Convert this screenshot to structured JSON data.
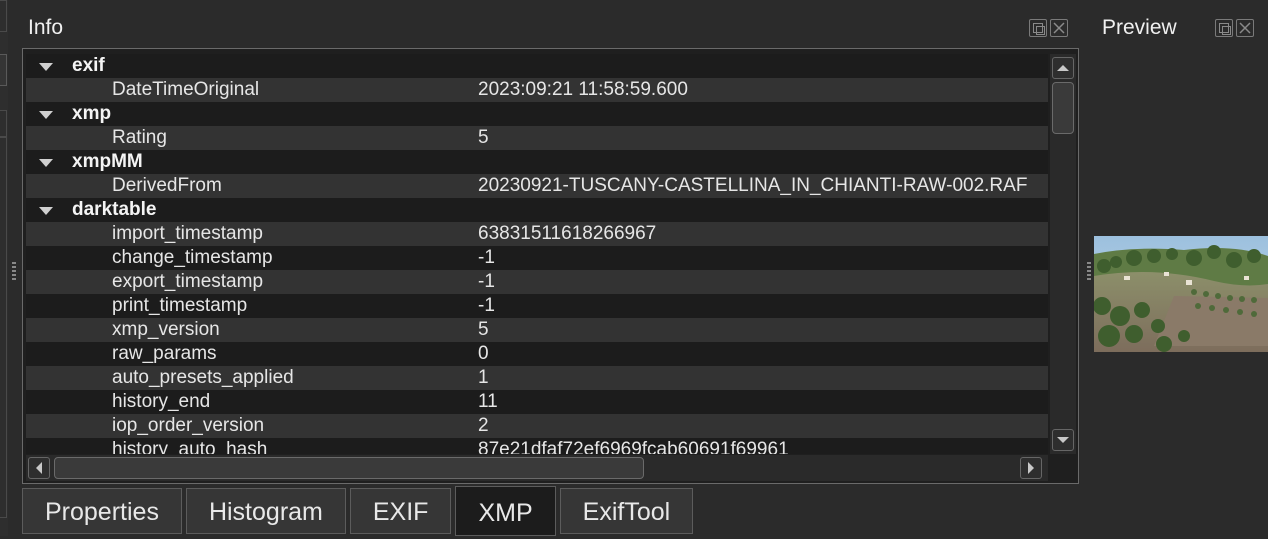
{
  "info_panel": {
    "title": "Info"
  },
  "preview_panel": {
    "title": "Preview"
  },
  "tree": {
    "rows": [
      {
        "kind": "group",
        "name": "exif"
      },
      {
        "kind": "item",
        "name": "DateTimeOriginal",
        "value": "2023:09:21 11:58:59.600"
      },
      {
        "kind": "group",
        "name": "xmp"
      },
      {
        "kind": "item",
        "name": "Rating",
        "value": "5"
      },
      {
        "kind": "group",
        "name": "xmpMM"
      },
      {
        "kind": "item",
        "name": "DerivedFrom",
        "value": "20230921-TUSCANY-CASTELLINA_IN_CHIANTI-RAW-002.RAF"
      },
      {
        "kind": "group",
        "name": "darktable"
      },
      {
        "kind": "item",
        "name": "import_timestamp",
        "value": "63831511618266967"
      },
      {
        "kind": "item",
        "name": "change_timestamp",
        "value": "-1"
      },
      {
        "kind": "item",
        "name": "export_timestamp",
        "value": "-1"
      },
      {
        "kind": "item",
        "name": "print_timestamp",
        "value": "-1"
      },
      {
        "kind": "item",
        "name": "xmp_version",
        "value": "5"
      },
      {
        "kind": "item",
        "name": "raw_params",
        "value": "0"
      },
      {
        "kind": "item",
        "name": "auto_presets_applied",
        "value": "1"
      },
      {
        "kind": "item",
        "name": "history_end",
        "value": "11"
      },
      {
        "kind": "item",
        "name": "iop_order_version",
        "value": "2"
      },
      {
        "kind": "item",
        "name": "history_auto_hash",
        "value": "87e21dfaf72ef6969fcab60691f69961"
      }
    ]
  },
  "tabs": [
    {
      "label": "Properties",
      "active": false
    },
    {
      "label": "Histogram",
      "active": false
    },
    {
      "label": "EXIF",
      "active": false
    },
    {
      "label": "XMP",
      "active": true
    },
    {
      "label": "ExifTool",
      "active": false
    }
  ]
}
